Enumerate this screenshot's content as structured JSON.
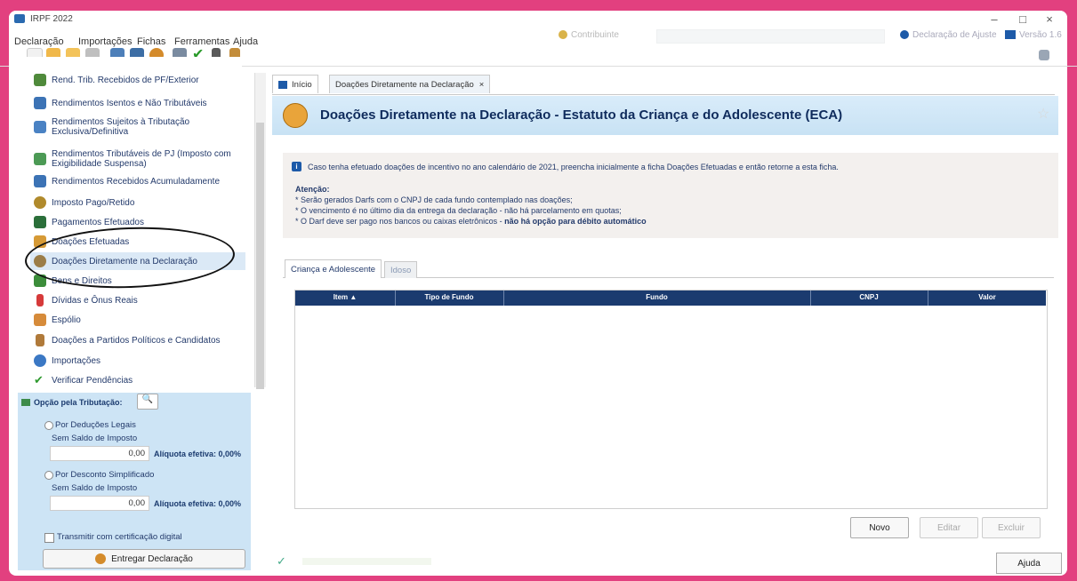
{
  "window": {
    "title": "IRPF 2022",
    "minimize": "–",
    "maximize": "□",
    "close": "×"
  },
  "menu": [
    "Declaração",
    "Importações",
    "Fichas",
    "Ferramentas",
    "Ajuda"
  ],
  "contribuinte_label": "Contribuinte",
  "declaracao_ajuste": "Declaração de Ajuste",
  "versao": "Versão 1.6",
  "sidebar": {
    "items": [
      {
        "label": "Rend. Trib. Recebidos de PF/Exterior",
        "icon": "coins-icon",
        "color": "#4f8a3b"
      },
      {
        "label": "Rendimentos Isentos e Não Tributáveis",
        "icon": "document-icon",
        "color": "#3c73b5"
      },
      {
        "label": "Rendimentos Sujeitos à Tributação",
        "label2": "Exclusiva/Definitiva",
        "icon": "document-icon",
        "color": "#4a82c3"
      },
      {
        "label": "Rendimentos Tributáveis de PJ (Imposto com",
        "label2": "Exigibilidade Suspensa)",
        "icon": "coins-icon",
        "color": "#4c9a55"
      },
      {
        "label": "Rendimentos Recebidos Acumuladamente",
        "icon": "document-icon",
        "color": "#3c73b5"
      },
      {
        "label": "Imposto Pago/Retido",
        "icon": "person-money-icon",
        "color": "#b08a2c"
      },
      {
        "label": "Pagamentos Efetuados",
        "icon": "card-icon",
        "color": "#2b6f3a"
      },
      {
        "label": "Doações Efetuadas",
        "icon": "gift-icon",
        "color": "#d69a36"
      },
      {
        "label": "Doações Diretamente na Declaração",
        "icon": "donation-icon",
        "color": "#9b7d48"
      },
      {
        "label": "Bens e Direitos",
        "icon": "house-icon",
        "color": "#3c8d3a"
      },
      {
        "label": "Dívidas e Ônus Reais",
        "icon": "arrow-down-icon",
        "color": "#d63a3a"
      },
      {
        "label": "Espólio",
        "icon": "family-icon",
        "color": "#d68b3a"
      },
      {
        "label": "Doações a Partidos Políticos e Candidatos",
        "icon": "candidate-icon",
        "color": "#b07a3a"
      },
      {
        "label": "Importações",
        "icon": "import-icon",
        "color": "#3b78c4"
      },
      {
        "label": "Verificar Pendências",
        "icon": "check-icon",
        "color": "#2f9a2f"
      }
    ]
  },
  "taxation": {
    "title": "Opção pela Tributação:",
    "search_icon": "🔍",
    "option1": "Por Deduções Legais",
    "option1_sub": "Sem Saldo de Imposto",
    "option1_value": "0,00",
    "option1_aliq": "Alíquota efetiva: 0,00%",
    "option2": "Por Desconto Simplificado",
    "option2_sub": "Sem Saldo de Imposto",
    "option2_value": "0,00",
    "option2_aliq": "Alíquota efetiva: 0,00%",
    "certificate": "Transmitir com certificação digital",
    "deliver": "Entregar Declaração"
  },
  "tabs": {
    "inicio": "Início",
    "current": "Doações Diretamente na Declaração",
    "current_close": "×"
  },
  "header": {
    "title": "Doações Diretamente na Declaração - Estatuto da Criança e do Adolescente (ECA)",
    "star": "☆"
  },
  "info": {
    "icon": "i",
    "line1": "Caso tenha efetuado doações de incentivo no ano calendário de 2021, preencha inicialmente a ficha Doações Efetuadas e então retorne a esta ficha.",
    "attention": "Atenção:",
    "bullet1": "* Serão gerados Darfs com o CNPJ de cada fundo contemplado nas doações;",
    "bullet2": "* O vencimento é no último dia da entrega da declaração - não há parcelamento em quotas;",
    "bullet3_plain": "* O Darf deve ser pago nos bancos ou caixas eletrônicos - ",
    "bullet3_bold": "não há opção para débito automático"
  },
  "subtabs": [
    "Criança e Adolescente",
    "Idoso"
  ],
  "table": {
    "columns": [
      "Item ▲",
      "Tipo de Fundo",
      "Fundo",
      "CNPJ",
      "Valor"
    ]
  },
  "buttons": {
    "novo": "Novo",
    "editar": "Editar",
    "excluir": "Excluir",
    "ajuda": "Ajuda"
  }
}
